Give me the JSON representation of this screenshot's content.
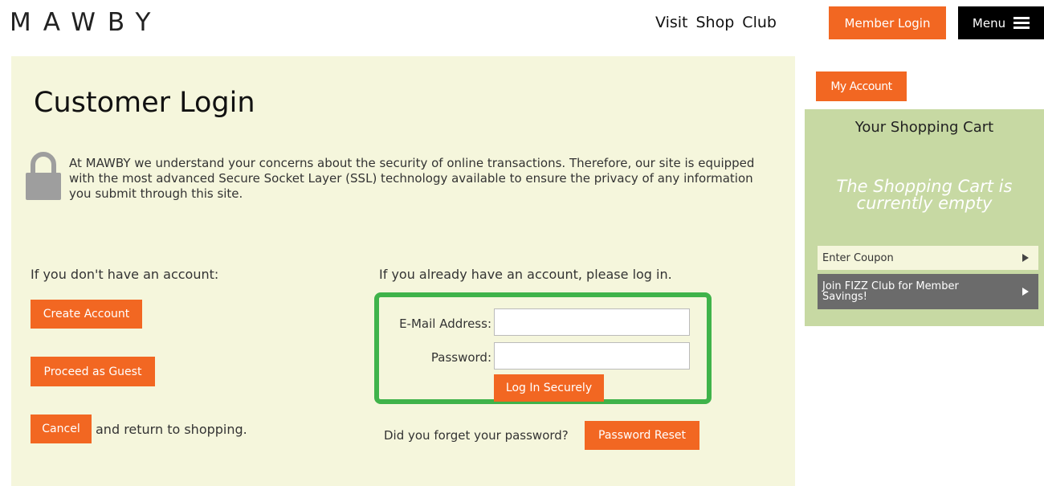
{
  "header": {
    "logo": "MAWBY",
    "nav": [
      "Visit",
      "Shop",
      "Club"
    ],
    "member_login": "Member Login",
    "menu": "Menu"
  },
  "main": {
    "title": "Customer Login",
    "intro": "At MAWBY we understand your concerns about the security of online transactions. Therefore, our site is equipped with the most advanced Secure Socket Layer (SSL) technology available to ensure the privacy of any information you submit through this site.",
    "left": {
      "heading": "If you don't have an account:",
      "create_account": "Create Account",
      "proceed_guest": "Proceed as Guest",
      "cancel": "Cancel",
      "return_text": "and return to shopping."
    },
    "right": {
      "heading": "If you already have an account, please log in.",
      "email_label": "E-Mail Address:",
      "email_value": "",
      "password_label": "Password:",
      "password_value": "",
      "login_button": "Log In Securely",
      "forgot_text": "Did you forget your password?",
      "reset_button": "Password Reset"
    }
  },
  "sidebar": {
    "my_account": "My Account",
    "cart_title": "Your Shopping Cart",
    "cart_empty": "The Shopping Cart is currently empty",
    "coupon": "Enter Coupon",
    "fizz": "Join FIZZ Club for Member Savings!"
  },
  "colors": {
    "accent": "#f26722",
    "login_border": "#3fb34a",
    "main_bg": "#f5f6dc",
    "cart_bg": "#c7d9a3"
  }
}
